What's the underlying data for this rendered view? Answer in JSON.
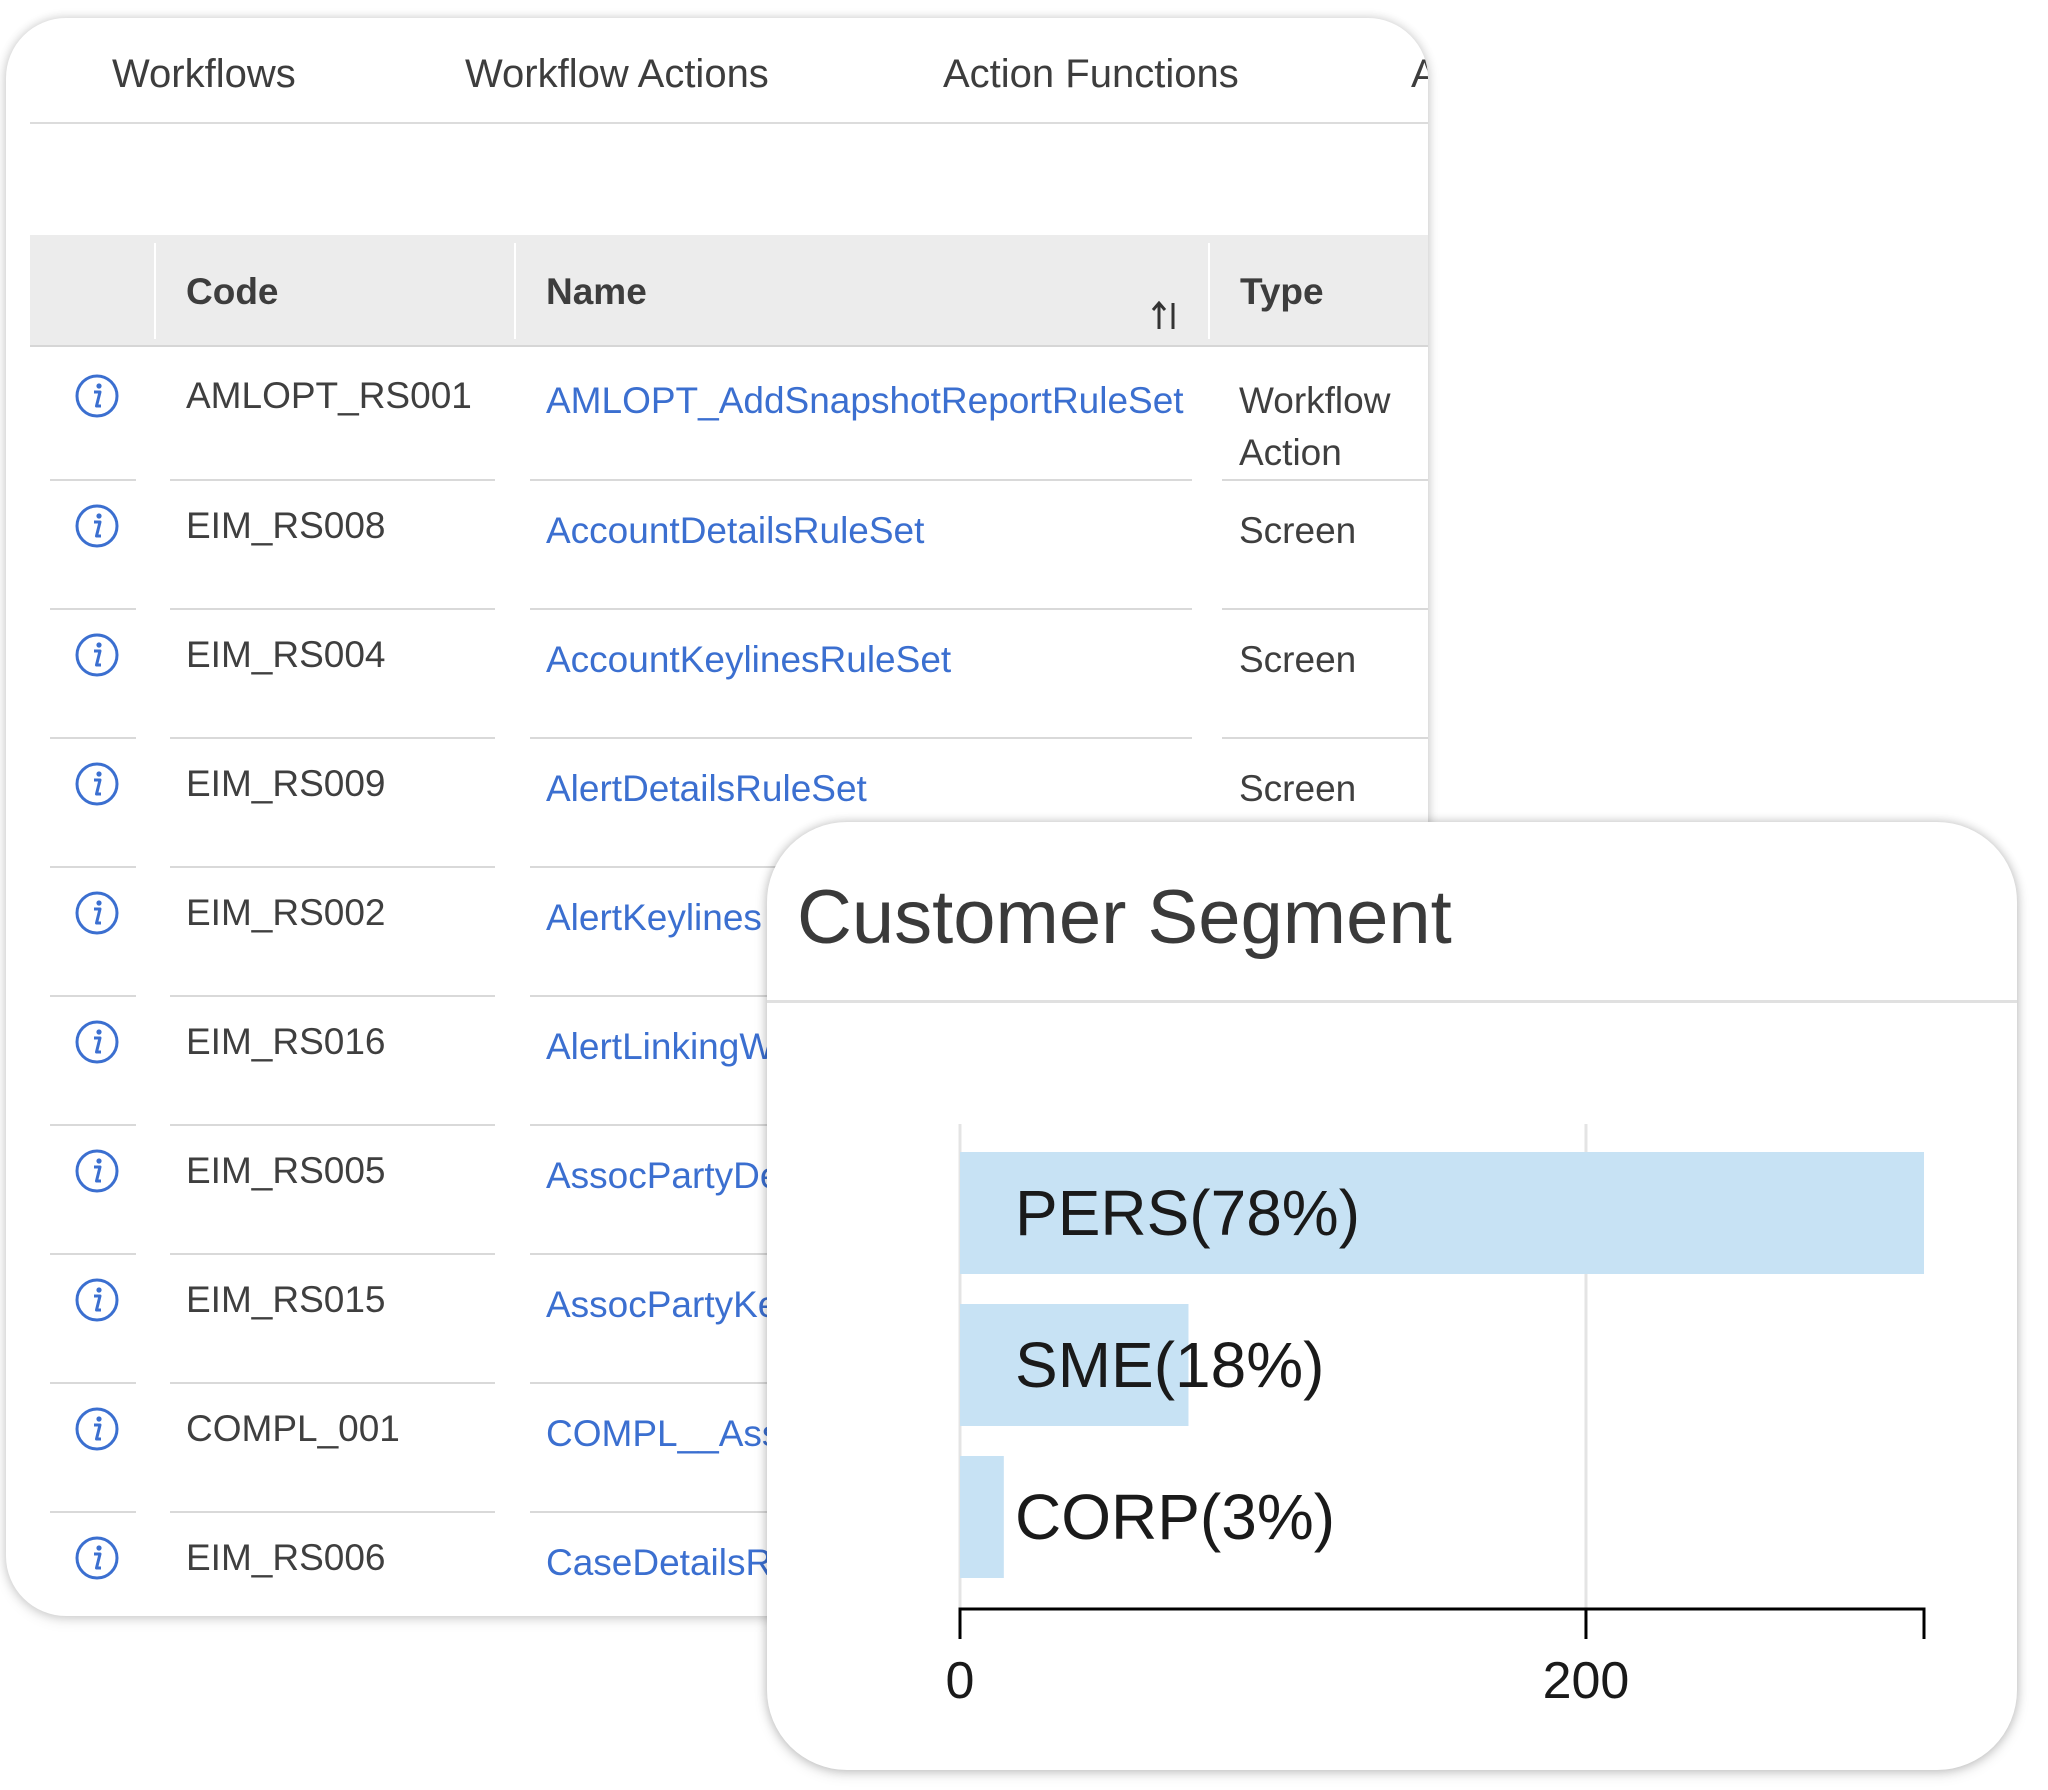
{
  "tabs": [
    {
      "label": "Workflows"
    },
    {
      "label": "Workflow Actions"
    },
    {
      "label": "Action Functions"
    },
    {
      "label": "A"
    }
  ],
  "table": {
    "columns": {
      "code": "Code",
      "name": "Name",
      "type": "Type"
    },
    "rows": [
      {
        "code": "AMLOPT_RS001",
        "name": "AMLOPT_AddSnapshotReportRuleSet",
        "type": "Workflow Action"
      },
      {
        "code": "EIM_RS008",
        "name": "AccountDetailsRuleSet",
        "type": "Screen"
      },
      {
        "code": "EIM_RS004",
        "name": "AccountKeylinesRuleSet",
        "type": "Screen"
      },
      {
        "code": "EIM_RS009",
        "name": "AlertDetailsRuleSet",
        "type": "Screen"
      },
      {
        "code": "EIM_RS002",
        "name": "AlertKeylines",
        "type": ""
      },
      {
        "code": "EIM_RS016",
        "name": "AlertLinkingW",
        "type": ""
      },
      {
        "code": "EIM_RS005",
        "name": "AssocPartyDe",
        "type": ""
      },
      {
        "code": "EIM_RS015",
        "name": "AssocPartyKe",
        "type": ""
      },
      {
        "code": "COMPL_001",
        "name": "COMPL__Ass",
        "type": ""
      },
      {
        "code": "EIM_RS006",
        "name": "CaseDetailsR",
        "type": ""
      }
    ]
  },
  "chart_data": {
    "type": "bar",
    "orientation": "horizontal",
    "title": "Customer Segment",
    "categories": [
      "PERS(78%)",
      "SME(18%)",
      "CORP(3%)"
    ],
    "values": [
      308,
      73,
      14
    ],
    "xlim": [
      0,
      308
    ],
    "xticks": [
      "0",
      "200"
    ],
    "grid": true,
    "colors": {
      "bar": "#c7e2f4",
      "axis": "#000000",
      "grid": "#e4e4e4"
    }
  }
}
